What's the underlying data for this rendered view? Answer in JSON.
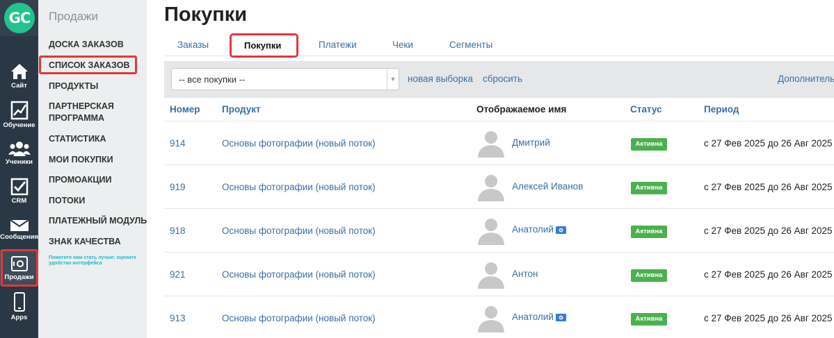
{
  "logo": {
    "text": "GC"
  },
  "rail": {
    "items": [
      {
        "label": "Сайт",
        "icon": "home-icon"
      },
      {
        "label": "Обучение",
        "icon": "chart-icon"
      },
      {
        "label": "Ученики",
        "icon": "users-icon"
      },
      {
        "label": "CRM",
        "icon": "checkbox-icon"
      },
      {
        "label": "Сообщения",
        "icon": "envelope-icon"
      },
      {
        "label": "Продажи",
        "icon": "safe-icon"
      },
      {
        "label": "Apps",
        "icon": "phone-icon"
      }
    ]
  },
  "subnav": {
    "title": "Продажи",
    "items": [
      "ДОСКА ЗАКАЗОВ",
      "СПИСОК ЗАКАЗОВ",
      "ПРОДУКТЫ",
      "ПАРТНЕРСКАЯ\nПРОГРАММА",
      "СТАТИСТИКА",
      "МОИ ПОКУПКИ",
      "ПРОМОАКЦИИ",
      "ПОТОКИ",
      "ПЛАТЕЖНЫЙ МОДУЛЬ",
      "ЗНАК КАЧЕСТВА"
    ],
    "feedback": "Помогите нам стать лучше: оцените удобство интерфейса"
  },
  "page": {
    "title": "Покупки"
  },
  "tabs": [
    "Заказы",
    "Покупки",
    "Платежи",
    "Чеки",
    "Сегменты"
  ],
  "filter": {
    "select_value": "-- все покупки --",
    "new_selection": "новая выборка",
    "reset": "сбросить",
    "additional": "Дополнитель"
  },
  "table": {
    "headers": {
      "number": "Номер",
      "product": "Продукт",
      "display_name": "Отображаемое имя",
      "status": "Статус",
      "period": "Период"
    },
    "rows": [
      {
        "number": "914",
        "product": "Основы фотографии (новый поток)",
        "name": "Дмитрий",
        "money": false,
        "status": "Активна",
        "period": "с 27 Фев 2025 до 26 Авг 2025"
      },
      {
        "number": "919",
        "product": "Основы фотографии (новый поток)",
        "name": "Алексей Иванов",
        "money": false,
        "status": "Активна",
        "period": "с 27 Фев 2025 до 26 Авг 2025"
      },
      {
        "number": "918",
        "product": "Основы фотографии (новый поток)",
        "name": "Анатолий",
        "money": true,
        "status": "Активна",
        "period": "с 27 Фев 2025 до 26 Авг 2025"
      },
      {
        "number": "921",
        "product": "Основы фотографии (новый поток)",
        "name": "Антон",
        "money": false,
        "status": "Активна",
        "period": "с 27 Фев 2025 до 26 Авг 2025"
      },
      {
        "number": "913",
        "product": "Основы фотографии (новый поток)",
        "name": "Анатолий",
        "money": true,
        "status": "Активна",
        "period": "с 27 Фев 2025 до 26 Авг 2025"
      }
    ]
  },
  "colors": {
    "rail_bg": "#2a3845",
    "logo": "#21c48c",
    "link": "#3a6ea5",
    "highlight": "#e0393b",
    "status_active": "#4caf50"
  }
}
